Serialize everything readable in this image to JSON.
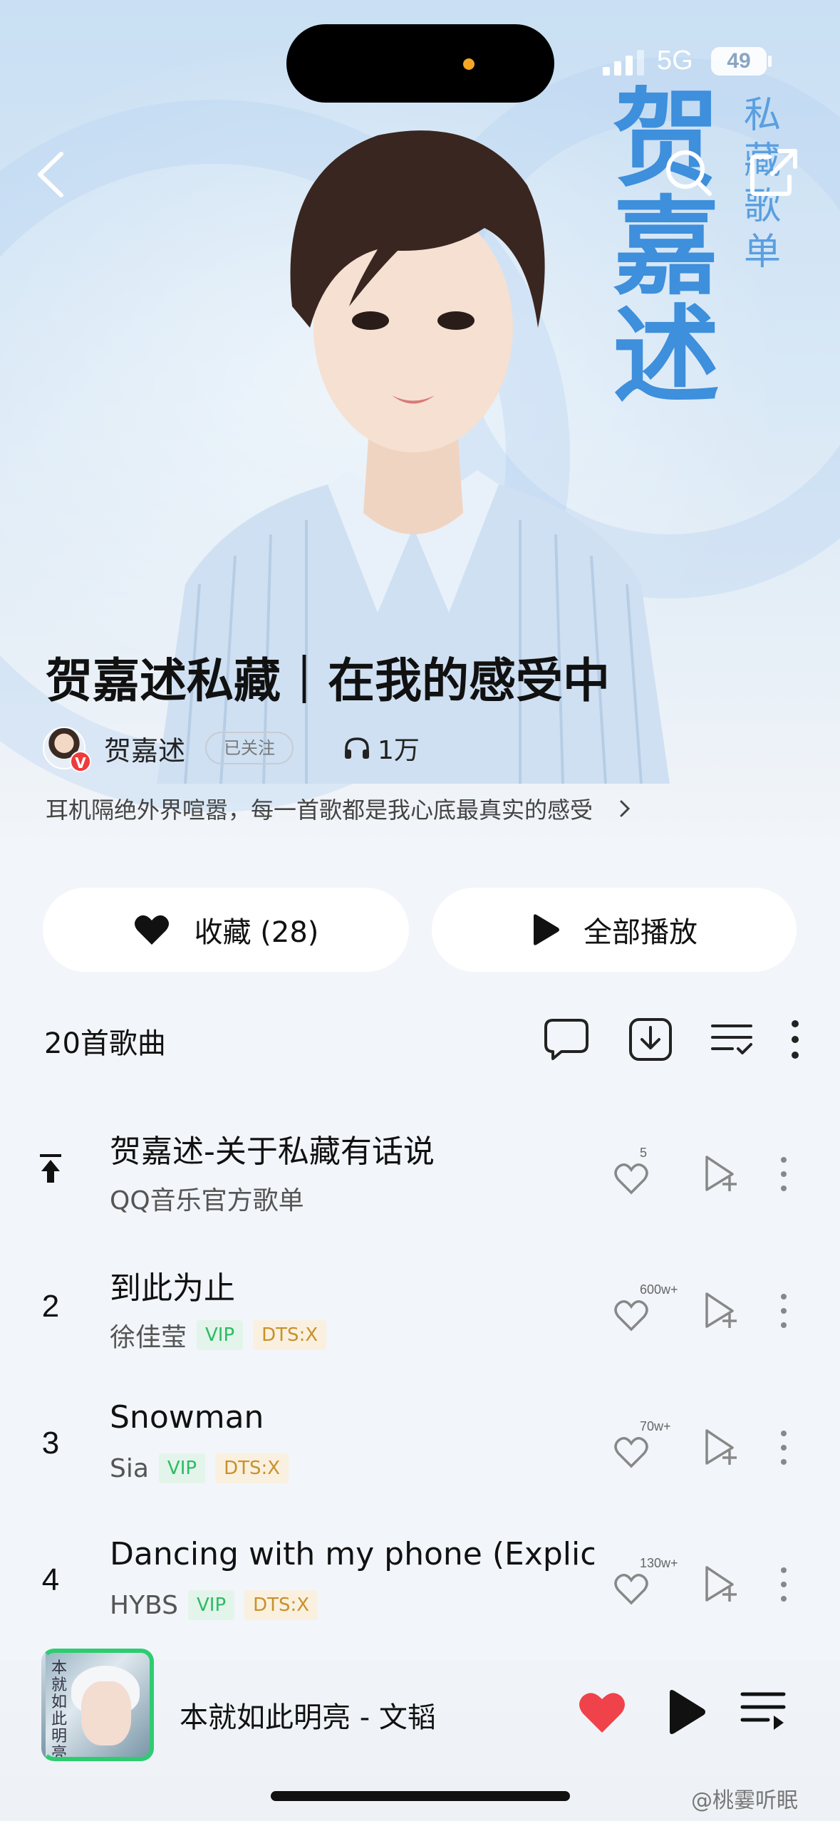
{
  "status": {
    "network": "5G",
    "battery": "49"
  },
  "hero": {
    "big_title": "贺嘉述",
    "small_title": "私藏歌单"
  },
  "playlist": {
    "title": "贺嘉述私藏｜在我的感受中",
    "creator": "贺嘉述",
    "creator_badge": "V",
    "follow_status": "已关注",
    "listen_count": "1万",
    "description": "耳机隔绝外界喧嚣，每一首歌都是我心底最真实的感受"
  },
  "actions": {
    "collect_label": "收藏 (28)",
    "play_all_label": "全部播放"
  },
  "list": {
    "count_label": "20首歌曲",
    "songs": [
      {
        "index": "",
        "pinned": true,
        "title": "贺嘉述-关于私藏有话说",
        "artist": "QQ音乐官方歌单",
        "vip": "",
        "dts": "",
        "likes": "5"
      },
      {
        "index": "2",
        "title": "到此为止",
        "artist": "徐佳莹",
        "vip": "VIP",
        "dts": "DTS:X",
        "likes": "600w+"
      },
      {
        "index": "3",
        "title": "Snowman",
        "artist": "Sia",
        "vip": "VIP",
        "dts": "DTS:X",
        "likes": "70w+"
      },
      {
        "index": "4",
        "title": "Dancing with my phone (Explic...",
        "artist": "HYBS",
        "vip": "VIP",
        "dts": "DTS:X",
        "likes": "130w+"
      }
    ]
  },
  "player": {
    "now_playing": "本就如此明亮 - 文韬",
    "cover_text": "本就如此明亮"
  },
  "watermark": "@桃霎听眠",
  "colors": {
    "accent_blue": "#3e8fdc",
    "vip_green": "#2dbb64",
    "dts_gold": "#c8912a",
    "like_red": "#f0424a"
  },
  "icons": [
    "back-arrow-icon",
    "search-icon",
    "share-icon",
    "heart-icon",
    "play-icon",
    "headphones-icon",
    "comment-icon",
    "download-icon",
    "sort-list-icon",
    "more-icon",
    "pin-top-icon",
    "add-to-playlist-icon",
    "queue-icon"
  ]
}
